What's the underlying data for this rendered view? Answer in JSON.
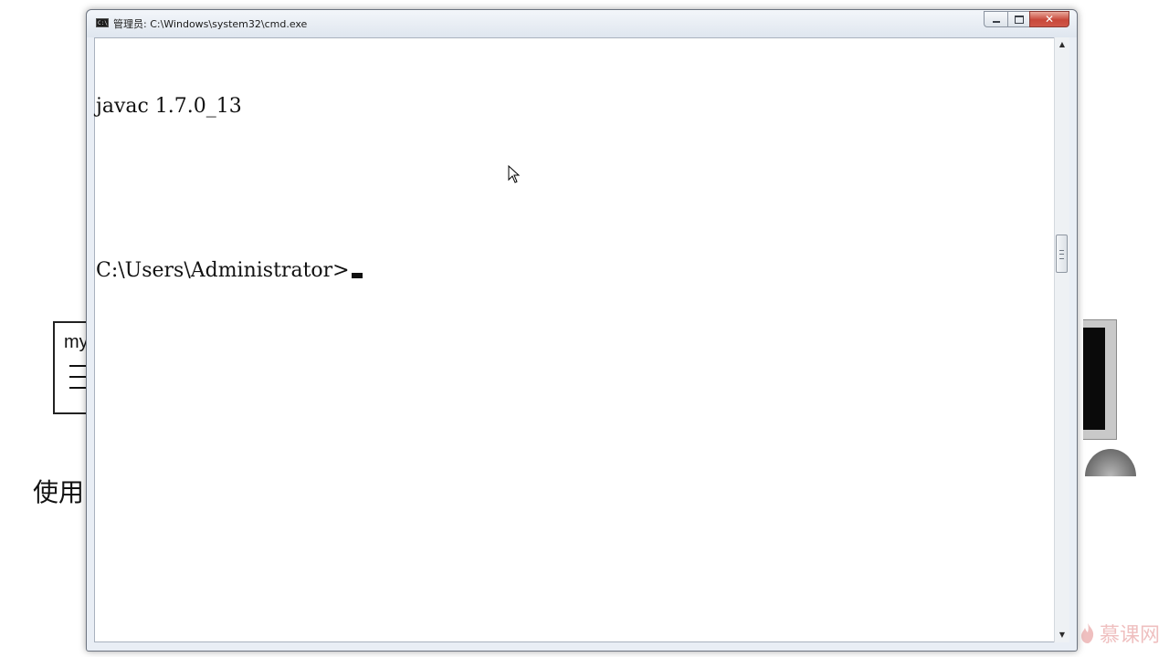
{
  "background": {
    "box_text": "my",
    "caption": "使用"
  },
  "window": {
    "title": "管理员: C:\\Windows\\system32\\cmd.exe",
    "icon": "console-icon",
    "buttons": {
      "minimize_icon": "minimize-icon",
      "maximize_icon": "maximize-icon",
      "close_label": "✕"
    }
  },
  "console": {
    "lines": [
      "javac 1.7.0_13",
      "",
      "C:\\Users\\Administrator>"
    ]
  },
  "scrollbar": {
    "up_arrow": "▲",
    "down_arrow": "▼"
  },
  "watermark": {
    "text": "慕课网",
    "color": "#d24b4b"
  }
}
